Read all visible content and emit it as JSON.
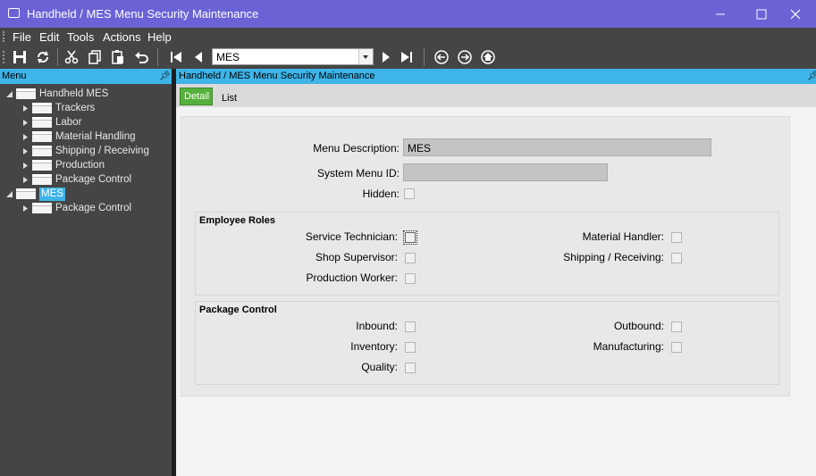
{
  "window": {
    "title": "Handheld / MES Menu Security Maintenance"
  },
  "menubar": {
    "items": [
      "File",
      "Edit",
      "Tools",
      "Actions",
      "Help"
    ]
  },
  "toolbar": {
    "nav_value": "MES",
    "icons": [
      "save-icon",
      "refresh-icon",
      "cut-icon",
      "copy-icon",
      "paste-icon",
      "undo-icon",
      "first-record-icon",
      "previous-record-icon",
      "next-record-icon",
      "last-record-icon",
      "back-icon",
      "forward-icon",
      "home-icon"
    ]
  },
  "sidebar": {
    "title": "Menu",
    "tree": [
      {
        "label": "Handheld MES",
        "level": 0,
        "expanded": true,
        "selected": false
      },
      {
        "label": "Trackers",
        "level": 1,
        "expanded": false,
        "selected": false
      },
      {
        "label": "Labor",
        "level": 1,
        "expanded": false,
        "selected": false
      },
      {
        "label": "Material Handling",
        "level": 1,
        "expanded": false,
        "selected": false
      },
      {
        "label": "Shipping / Receiving",
        "level": 1,
        "expanded": false,
        "selected": false
      },
      {
        "label": "Production",
        "level": 1,
        "expanded": false,
        "selected": false
      },
      {
        "label": "Package Control",
        "level": 1,
        "expanded": false,
        "selected": false
      },
      {
        "label": "MES",
        "level": 0,
        "expanded": true,
        "selected": true
      },
      {
        "label": "Package Control",
        "level": 1,
        "expanded": false,
        "selected": false
      }
    ]
  },
  "content": {
    "title": "Handheld / MES Menu Security Maintenance",
    "tabs": {
      "detail": "Detail",
      "list": "List"
    },
    "form": {
      "menu_description_label": "Menu Description:",
      "menu_description_value": "MES",
      "system_menu_id_label": "System Menu ID:",
      "system_menu_id_value": "",
      "hidden_label": "Hidden:"
    },
    "employee_roles": {
      "title": "Employee Roles",
      "service_technician": "Service Technician:",
      "shop_supervisor": "Shop Supervisor:",
      "production_worker": "Production Worker:",
      "material_handler": "Material Handler:",
      "shipping_receiving": "Shipping / Receiving:"
    },
    "package_control": {
      "title": "Package Control",
      "inbound": "Inbound:",
      "inventory": "Inventory:",
      "quality": "Quality:",
      "outbound": "Outbound:",
      "manufacturing": "Manufacturing:"
    }
  },
  "colors": {
    "titlebar": "#6b62d6",
    "accent": "#3eb4e8",
    "active_tab": "#56b03c",
    "dark_chrome": "#454545"
  }
}
